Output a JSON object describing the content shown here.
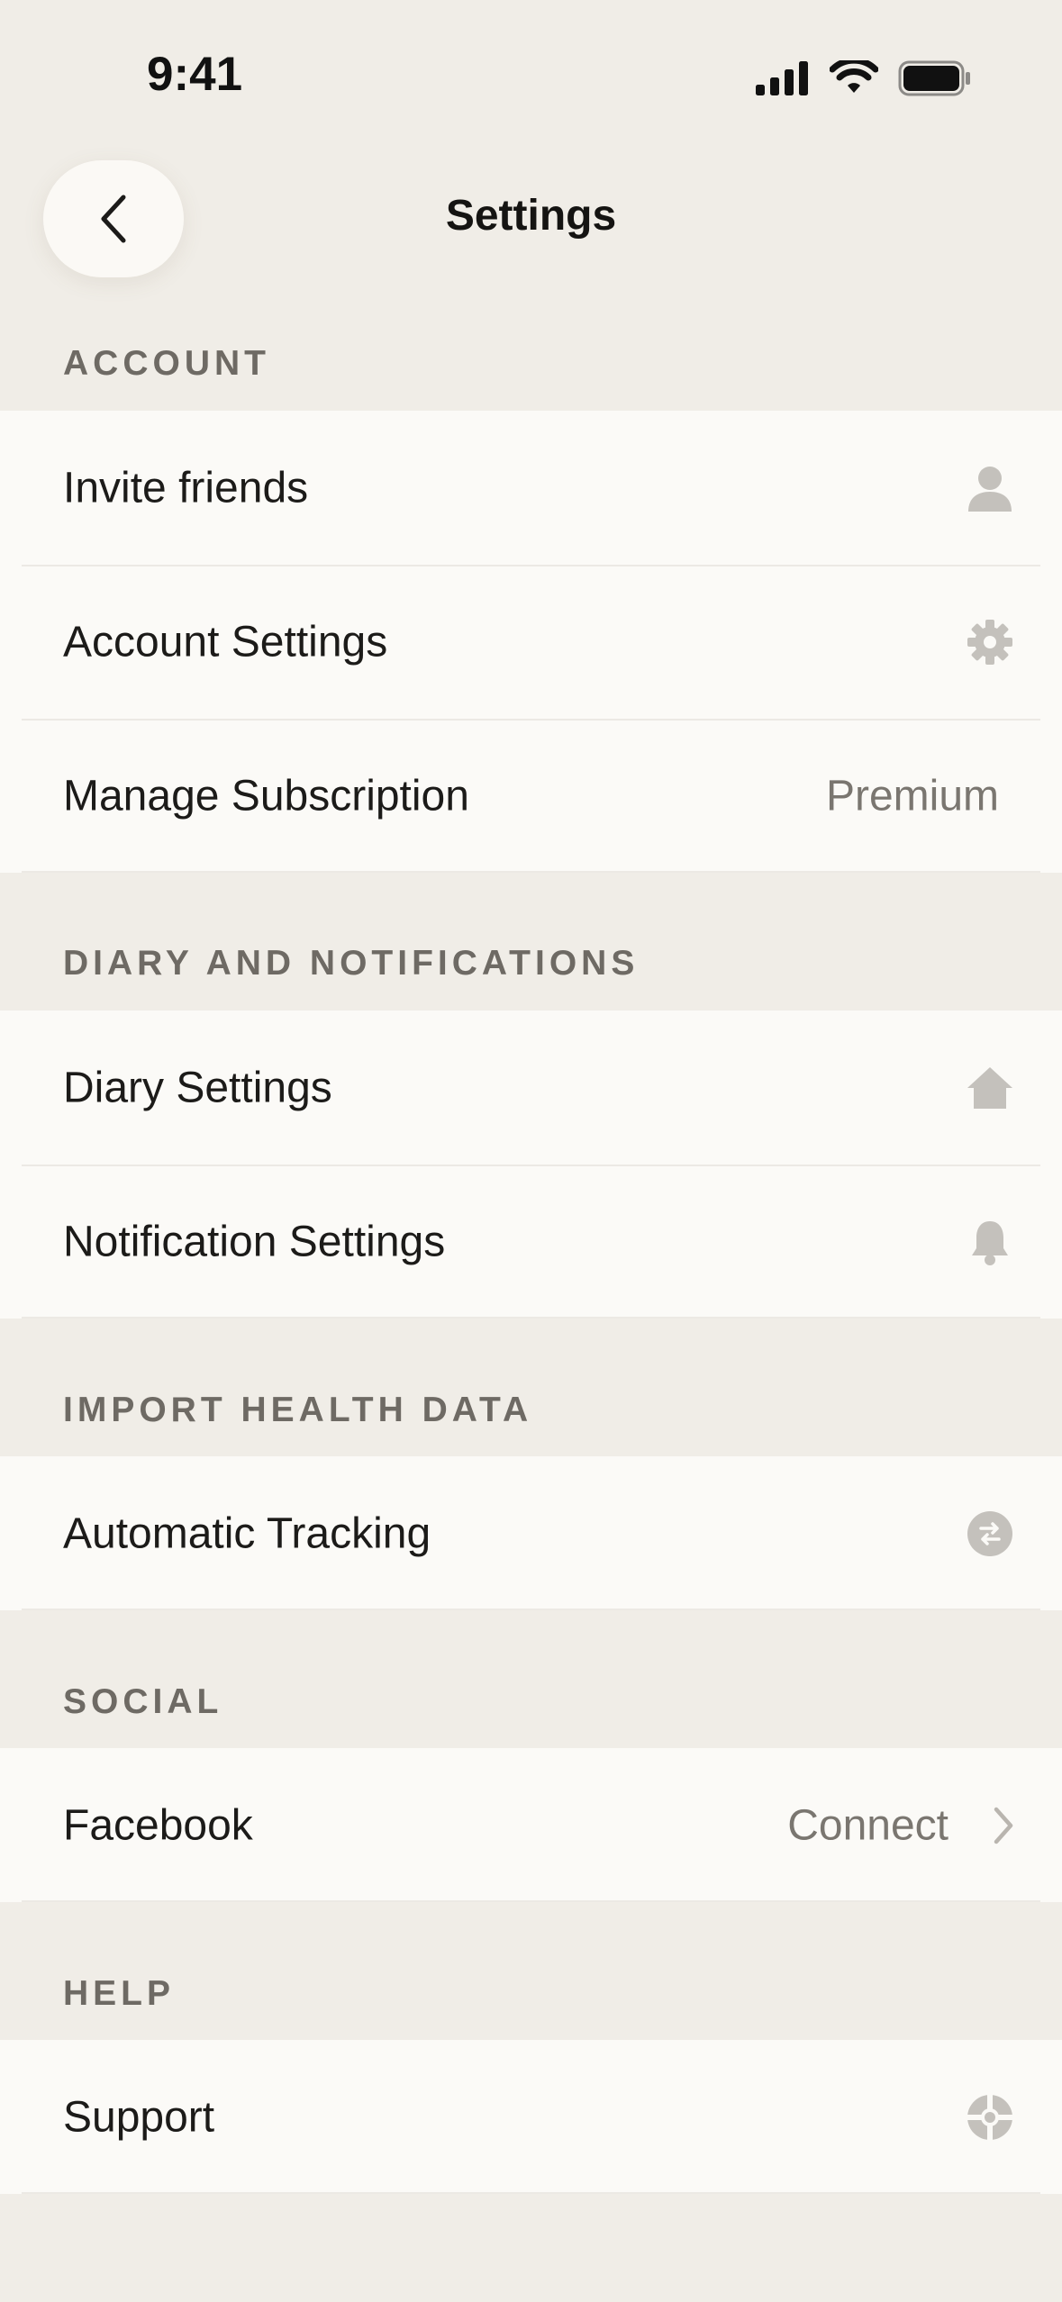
{
  "status_bar": {
    "time": "9:41"
  },
  "nav": {
    "title": "Settings"
  },
  "sections": {
    "account": {
      "header": "ACCOUNT",
      "items": [
        {
          "label": "Invite friends",
          "icon": "person-icon"
        },
        {
          "label": "Account Settings",
          "icon": "gear-icon"
        },
        {
          "label": "Manage Subscription",
          "value": "Premium"
        }
      ]
    },
    "diary": {
      "header": "DIARY AND NOTIFICATIONS",
      "items": [
        {
          "label": "Diary Settings",
          "icon": "home-icon"
        },
        {
          "label": "Notification Settings",
          "icon": "bell-icon"
        }
      ]
    },
    "health": {
      "header": "IMPORT HEALTH DATA",
      "items": [
        {
          "label": "Automatic Tracking",
          "icon": "sync-arrows-icon"
        }
      ]
    },
    "social": {
      "header": "SOCIAL",
      "items": [
        {
          "label": "Facebook",
          "value": "Connect",
          "icon": "chevron-right-icon"
        }
      ]
    },
    "help": {
      "header": "HELP",
      "items": [
        {
          "label": "Support",
          "icon": "lifebuoy-icon"
        }
      ]
    }
  },
  "colors": {
    "background": "#f0ede7",
    "row_background": "#fbfaf7",
    "icon_gray": "#c4c1bc",
    "secondary_text": "#7a7670",
    "section_header_text": "#6e6a64"
  }
}
